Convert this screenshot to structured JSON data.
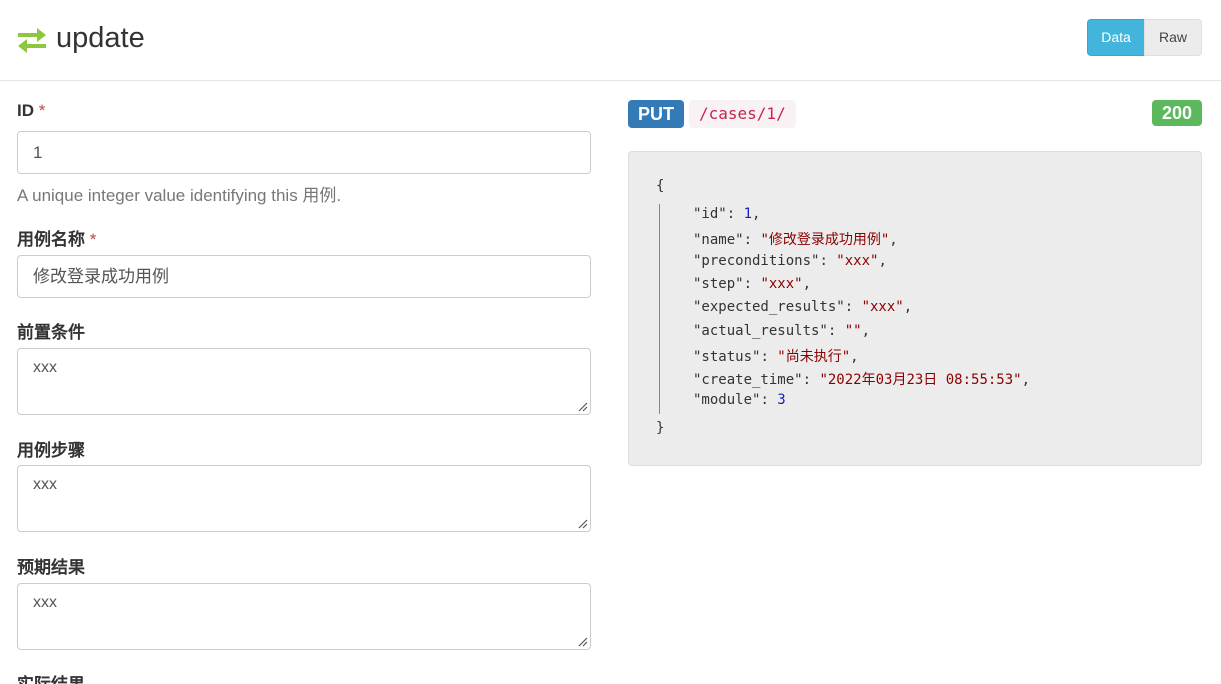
{
  "header": {
    "title": "update",
    "view_data": "Data",
    "view_raw": "Raw"
  },
  "form": {
    "id": {
      "label": "ID",
      "required_mark": "*",
      "value": "1",
      "help": "A unique integer value identifying this 用例."
    },
    "name": {
      "label": "用例名称",
      "required_mark": "*",
      "value": "修改登录成功用例"
    },
    "preconditions": {
      "label": "前置条件",
      "value": "xxx"
    },
    "step": {
      "label": "用例步骤",
      "value": "xxx"
    },
    "expected_results": {
      "label": "预期结果",
      "value": "xxx"
    },
    "actual_results": {
      "label": "实际结果"
    }
  },
  "request": {
    "method": "PUT",
    "path": "/cases/1/",
    "status_code": "200"
  },
  "response": {
    "open_brace": "{",
    "close_brace": "}",
    "fields": [
      {
        "key": "\"id\"",
        "value": "1",
        "type": "number",
        "comma": ","
      },
      {
        "key": "\"name\"",
        "value": "\"修改登录成功用例\"",
        "type": "string",
        "comma": ","
      },
      {
        "key": "\"preconditions\"",
        "value": "\"xxx\"",
        "type": "string",
        "comma": ","
      },
      {
        "key": "\"step\"",
        "value": "\"xxx\"",
        "type": "string",
        "comma": ","
      },
      {
        "key": "\"expected_results\"",
        "value": "\"xxx\"",
        "type": "string",
        "comma": ","
      },
      {
        "key": "\"actual_results\"",
        "value": "\"\"",
        "type": "string",
        "comma": ","
      },
      {
        "key": "\"status\"",
        "value": "\"尚未执行\"",
        "type": "string",
        "comma": ","
      },
      {
        "key": "\"create_time\"",
        "value": "\"2022年03月23日 08:55:53\"",
        "type": "string",
        "comma": ","
      },
      {
        "key": "\"module\"",
        "value": "3",
        "type": "number",
        "comma": ""
      }
    ]
  },
  "colors": {
    "accent": "#43b5dc",
    "method_bg": "#337ab7",
    "status_bg": "#5cb85c",
    "icon": "#8dc63f",
    "string": "#8b0000",
    "number": "#1c1cb8"
  }
}
